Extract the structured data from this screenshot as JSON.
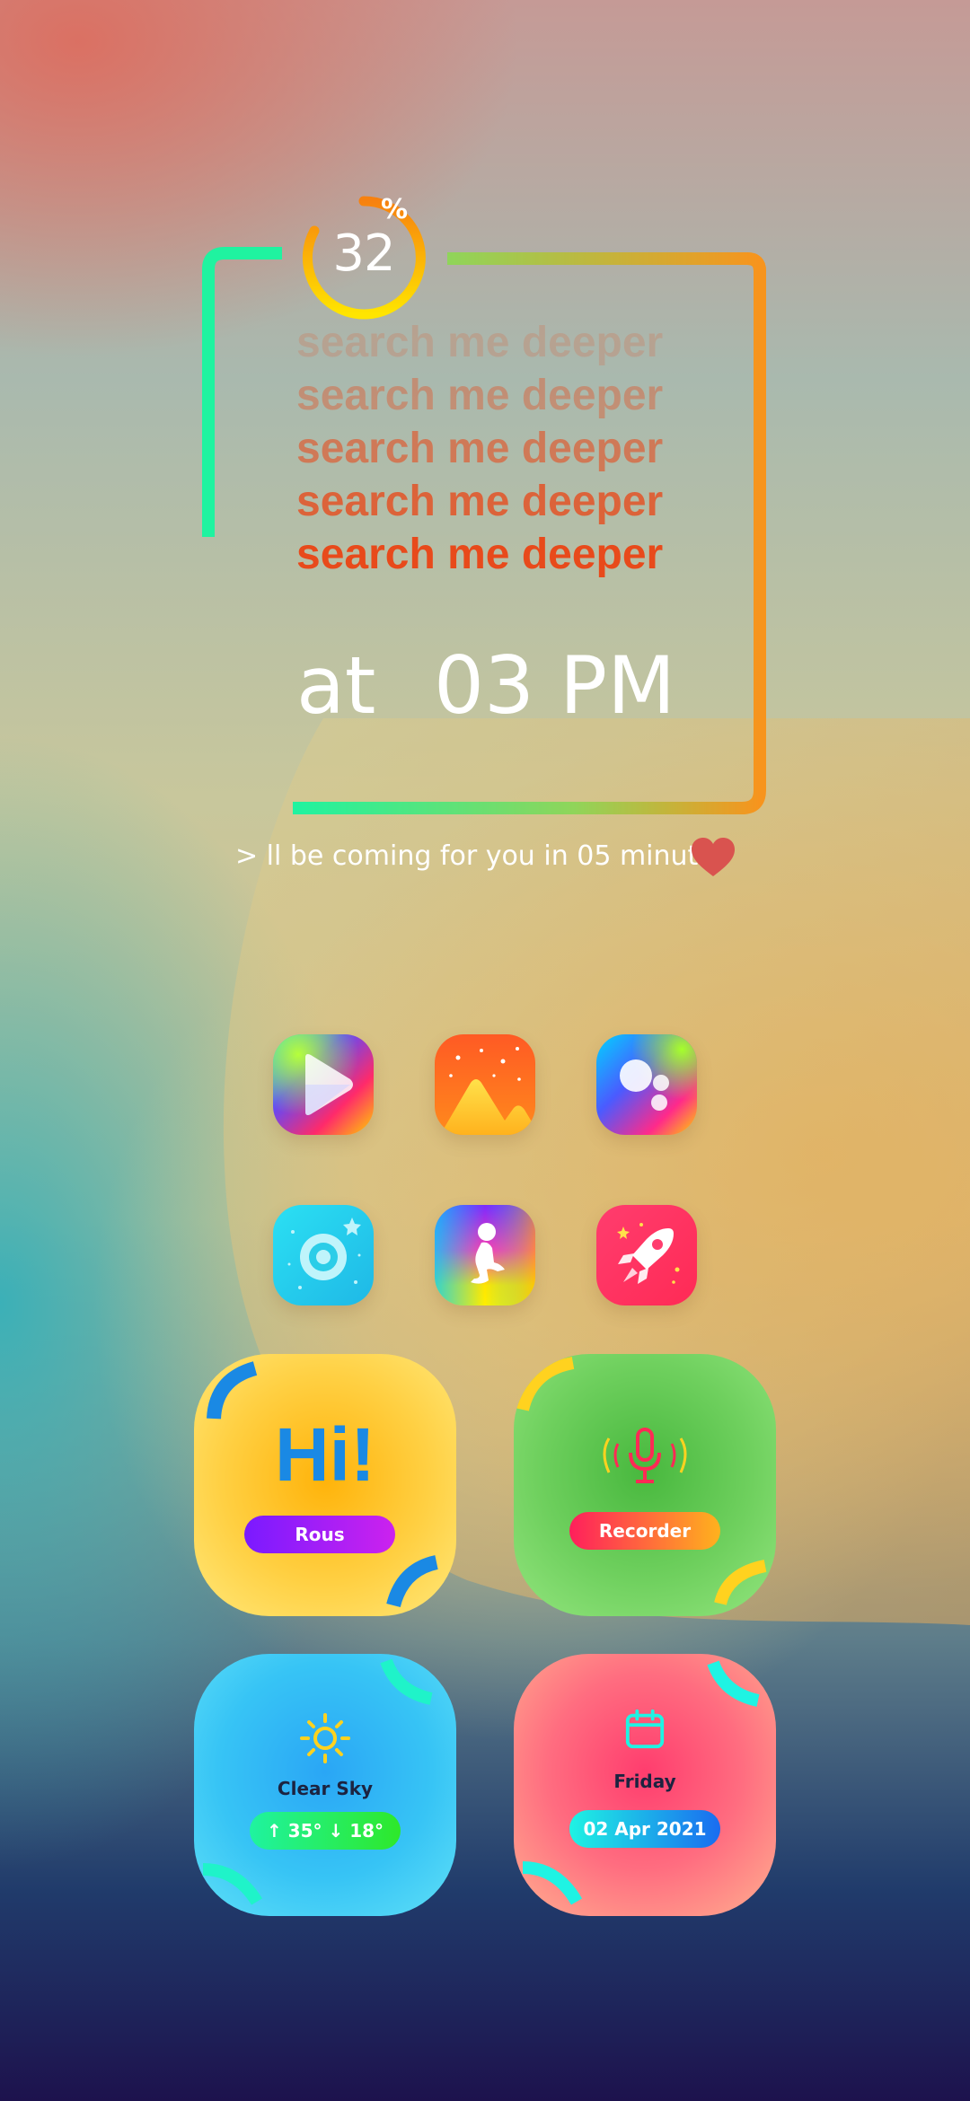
{
  "battery": {
    "value": "32",
    "unit": "%"
  },
  "phrases": [
    "search me deeper",
    "search me deeper",
    "search me deeper",
    "search me deeper",
    "search me deeper"
  ],
  "time": {
    "prefix": "at",
    "value": "03 PM"
  },
  "message": "> ll be coming for you in 05 minutes",
  "apps": [
    {
      "name": "play-store",
      "icon": "play-icon"
    },
    {
      "name": "gallery",
      "icon": "mountains-icon"
    },
    {
      "name": "bubbles",
      "icon": "bubbles-icon"
    },
    {
      "name": "camera",
      "icon": "target-icon"
    },
    {
      "name": "meditation",
      "icon": "person-icon"
    },
    {
      "name": "launcher",
      "icon": "rocket-icon"
    }
  ],
  "widgets": {
    "greeting": {
      "text": "Hi!",
      "button": "Rous"
    },
    "recorder": {
      "button": "Recorder",
      "icon": "microphone-icon"
    },
    "weather": {
      "condition": "Clear Sky",
      "temps": "↑ 35° ↓ 18°",
      "icon": "sun-icon"
    },
    "calendar": {
      "day": "Friday",
      "date": "02 Apr 2021",
      "icon": "calendar-icon"
    }
  },
  "colors": {
    "accent_orange": "#f7941d",
    "accent_green": "#1ff3a0",
    "phrase_red": "#e84a1b",
    "heart": "#d9534f"
  }
}
